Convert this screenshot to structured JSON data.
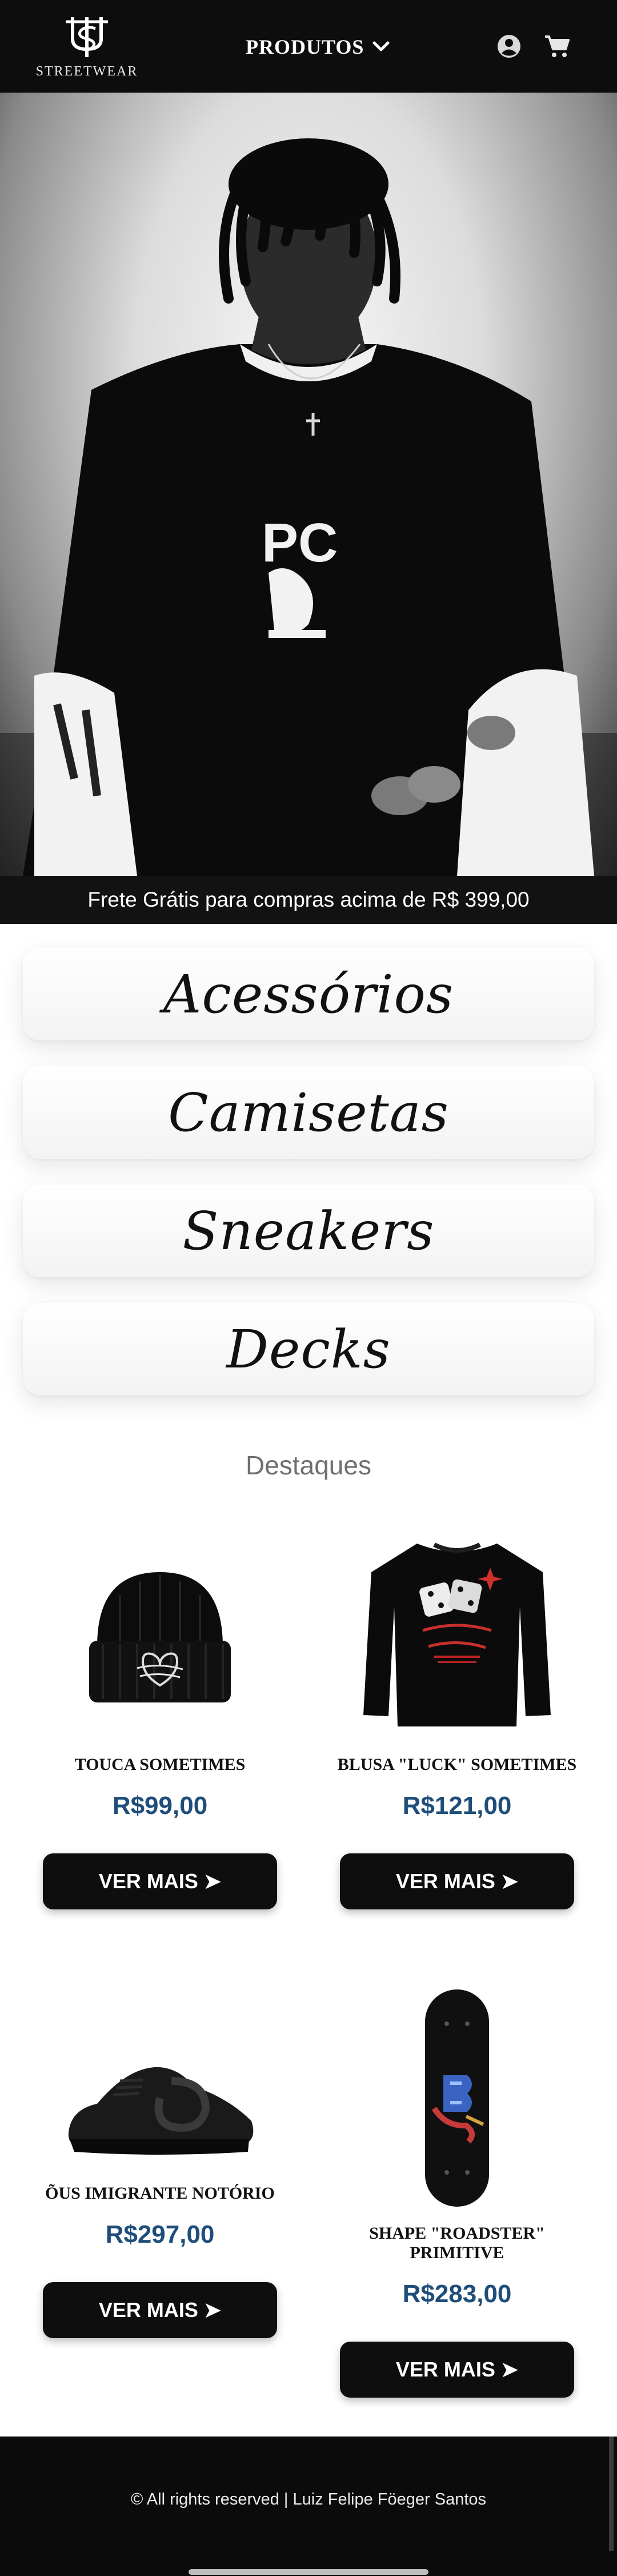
{
  "header": {
    "logo_text": "STREETWEAR",
    "nav_label": "PRODUTOS",
    "icons": [
      "user-icon",
      "cart-icon",
      "chevron-down-icon"
    ]
  },
  "hero": {
    "shirt_print": "PC",
    "banner_text": "Frete Grátis para compras acima de R$ 399,00"
  },
  "categories": [
    "Acessórios",
    "Camisetas",
    "Sneakers",
    "Decks"
  ],
  "featured": {
    "title": "Destaques",
    "products": [
      {
        "name": "TOUCA SOMETIMES",
        "price": "R$99,00",
        "button": "VER MAIS ➤"
      },
      {
        "name": "BLUSA \"LUCK\" SOMETIMES",
        "price": "R$121,00",
        "button": "VER MAIS ➤"
      },
      {
        "name": "ÕUS IMIGRANTE NOTÓRIO",
        "price": "R$297,00",
        "button": "VER MAIS ➤"
      },
      {
        "name": "SHAPE \"ROADSTER\" PRIMITIVE",
        "price": "R$283,00",
        "button": "VER MAIS ➤"
      }
    ]
  },
  "footer": {
    "text": "© All rights reserved | Luiz Felipe Föeger Santos"
  },
  "colors": {
    "header_bg": "#0d0d0d",
    "price": "#1f4e7a",
    "button_bg": "#0e0e0e"
  }
}
